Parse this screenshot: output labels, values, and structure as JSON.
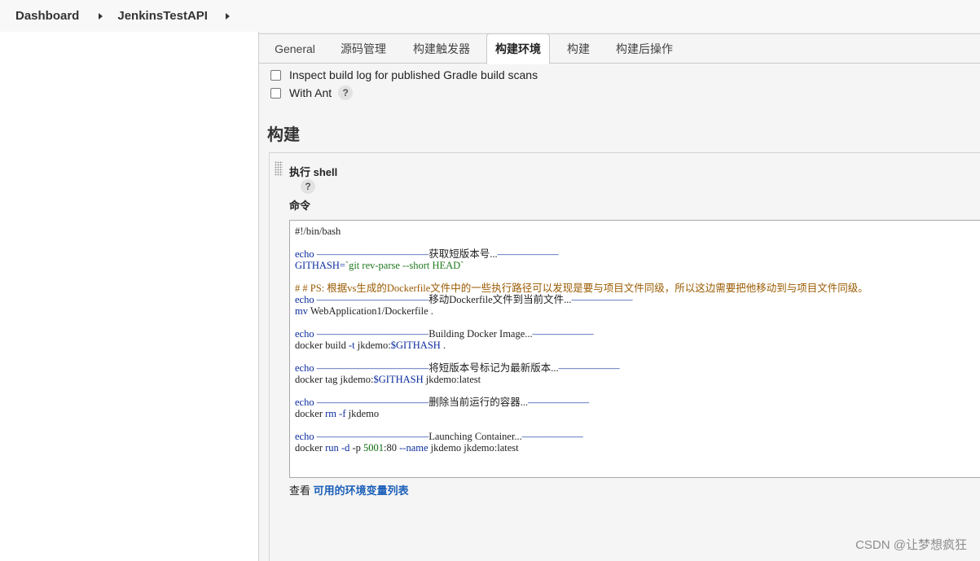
{
  "breadcrumb": {
    "items": [
      "Dashboard",
      "JenkinsTestAPI"
    ]
  },
  "tabs": [
    "General",
    "源码管理",
    "构建触发器",
    "构建环境",
    "构建",
    "构建后操作"
  ],
  "active_tab": "构建环境",
  "build_env": {
    "options": [
      {
        "label": "Inspect build log for published Gradle build scans",
        "checked": false,
        "has_help": false
      },
      {
        "label": "With Ant",
        "checked": false,
        "has_help": true
      }
    ]
  },
  "build_section": {
    "title": "构建",
    "step": {
      "title": "执行 shell",
      "help": "?",
      "command_label": "命令",
      "script_lines": [
        "#!/bin/bash",
        "",
        "echo ———————————获取短版本号...——————",
        "GITHASH=`git rev-parse --short HEAD`",
        "",
        "# # PS: 根据vs生成的Dockerfile文件中的一些执行路径可以发现是要与项目文件同级，所以这边需要把他移动到与项目文件同级。",
        "echo ———————————移动Dockerfile文件到当前文件...——————",
        "mv WebApplication1/Dockerfile .",
        "",
        "echo ———————————Building Docker Image...——————",
        "docker build -t jkdemo:$GITHASH .",
        "",
        "echo ———————————将短版本号标记为最新版本...——————",
        "docker tag jkdemo:$GITHASH jkdemo:latest",
        "",
        "echo ———————————删除当前运行的容器...——————",
        "docker rm -f jkdemo",
        "",
        "echo ———————————Launching Container...——————",
        "docker run -d -p 5001:80 --name jkdemo jkdemo:latest"
      ]
    },
    "env_link_prefix": "查看",
    "env_link_text": "可用的环境变量列表"
  },
  "help_glyph": "?",
  "watermark": "CSDN @让梦想疯狂",
  "icons": [
    "chevron-right-icon",
    "checkbox-icon",
    "help-icon",
    "drag-handle-icon"
  ]
}
